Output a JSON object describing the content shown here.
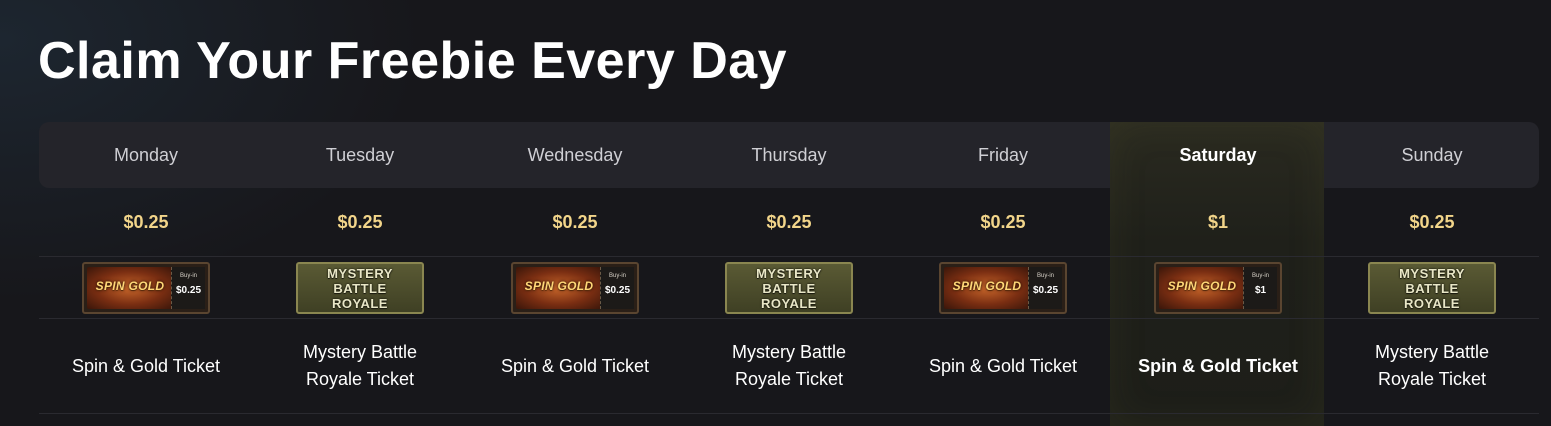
{
  "title": "Claim Your Freebie Every Day",
  "colors": {
    "price": "#f2d58a",
    "highlight_column": "#2a2a20",
    "header_bar": "#24242a"
  },
  "days": [
    {
      "day": "Monday",
      "price": "$0.25",
      "ticket_type": "spin",
      "stub_label": "Buy-in",
      "stub_value": "$0.25",
      "ticket_name": "Spin & Gold Ticket"
    },
    {
      "day": "Tuesday",
      "price": "$0.25",
      "ticket_type": "mbr",
      "ticket_name": "Mystery Battle Royale Ticket"
    },
    {
      "day": "Wednesday",
      "price": "$0.25",
      "ticket_type": "spin",
      "stub_label": "Buy-in",
      "stub_value": "$0.25",
      "ticket_name": "Spin & Gold Ticket"
    },
    {
      "day": "Thursday",
      "price": "$0.25",
      "ticket_type": "mbr",
      "ticket_name": "Mystery Battle Royale Ticket"
    },
    {
      "day": "Friday",
      "price": "$0.25",
      "ticket_type": "spin",
      "stub_label": "Buy-in",
      "stub_value": "$0.25",
      "ticket_name": "Spin & Gold Ticket"
    },
    {
      "day": "Saturday",
      "price": "$1",
      "ticket_type": "spin",
      "stub_label": "Buy-in",
      "stub_value": "$1",
      "ticket_name": "Spin & Gold Ticket",
      "active": true
    },
    {
      "day": "Sunday",
      "price": "$0.25",
      "ticket_type": "mbr",
      "ticket_name": "Mystery Battle Royale Ticket"
    }
  ],
  "ticket_art": {
    "spin_logo": "SPIN GOLD",
    "mbr_lines": [
      "MYSTERY",
      "BATTLE",
      "ROYALE"
    ]
  }
}
